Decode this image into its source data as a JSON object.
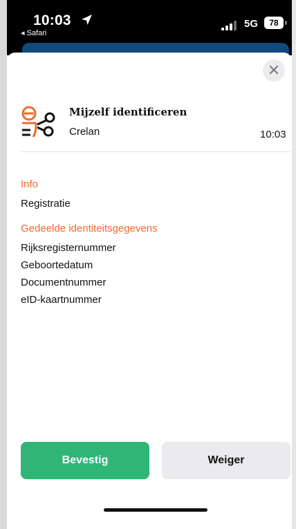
{
  "status_bar": {
    "time": "10:03",
    "back_app": "◂ Safari",
    "network": "5G",
    "battery": "78"
  },
  "sheet": {
    "close_glyph": "✕",
    "title": "Mijzelf identificeren",
    "subtitle": "Crelan",
    "timestamp": "10:03",
    "info": {
      "heading": "Info",
      "value": "Registratie"
    },
    "shared": {
      "heading": "Gedeelde identiteitsgegevens",
      "items": [
        "Rijksregisternummer",
        "Geboortedatum",
        "Documentnummer",
        "eID-kaartnummer"
      ]
    },
    "buttons": {
      "confirm": "Bevestig",
      "deny": "Weiger"
    }
  },
  "colors": {
    "accent_orange": "#ef6a2a",
    "confirm_green": "#2fb676"
  },
  "icons": {
    "logo": "itsme-share-identity-icon",
    "close": "close-icon",
    "location": "location-arrow-icon",
    "signal": "signal-bars-icon",
    "battery": "battery-icon"
  }
}
